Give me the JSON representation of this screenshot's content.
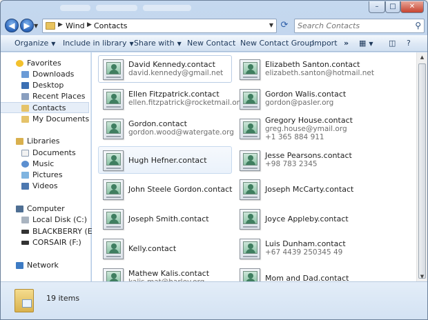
{
  "nav": {
    "back": "◀",
    "forward": "▶"
  },
  "address": {
    "crumbs": [
      "Wind",
      "Contacts"
    ]
  },
  "search": {
    "placeholder": "Search Contacts"
  },
  "commands": {
    "organize": "Organize",
    "include": "Include in library",
    "share": "Share with",
    "new_contact": "New Contact",
    "new_group": "New Contact Group",
    "import": "Import",
    "more": "»"
  },
  "sidebar": {
    "favorites": "Favorites",
    "downloads": "Downloads",
    "desktop": "Desktop",
    "recent": "Recent Places",
    "contacts": "Contacts",
    "documents_fav": "My Documents",
    "libraries": "Libraries",
    "lib_documents": "Documents",
    "lib_music": "Music",
    "lib_pictures": "Pictures",
    "lib_videos": "Videos",
    "computer": "Computer",
    "disk_c": "Local Disk (C:)",
    "disk_e": "BLACKBERRY (E:)",
    "disk_f": "CORSAIR (F:)",
    "network": "Network"
  },
  "contacts": [
    {
      "name": "David Kennedy.contact",
      "lines": [
        "david.kennedy@gmail.net"
      ]
    },
    {
      "name": "Elizabeth Santon.contact",
      "lines": [
        "elizabeth.santon@hotmail.net"
      ]
    },
    {
      "name": "Ellen Fitzpatrick.contact",
      "lines": [
        "ellen.fitzpatrick@rocketmail.org"
      ]
    },
    {
      "name": "Gordon Walis.contact",
      "lines": [
        "gordon@pasler.org"
      ]
    },
    {
      "name": "Gordon.contact",
      "lines": [
        "gordon.wood@watergate.org"
      ]
    },
    {
      "name": "Gregory House.contact",
      "lines": [
        "greg.house@ymail.org",
        "+1 365 884 911"
      ]
    },
    {
      "name": "Hugh Hefner.contact",
      "lines": []
    },
    {
      "name": "Jesse Pearsons.contact",
      "lines": [
        "+98 783 2345"
      ]
    },
    {
      "name": "John Steele Gordon.contact",
      "lines": []
    },
    {
      "name": "Joseph McCarty.contact",
      "lines": []
    },
    {
      "name": "Joseph Smith.contact",
      "lines": []
    },
    {
      "name": "Joyce Appleby.contact",
      "lines": []
    },
    {
      "name": "Kelly.contact",
      "lines": []
    },
    {
      "name": "Luis Dunham.contact",
      "lines": [
        "+67 4439 250345 49"
      ]
    },
    {
      "name": "Mathew Kalis.contact",
      "lines": [
        "kalis.mat@harley.org"
      ]
    },
    {
      "name": "Mom and Dad.contact",
      "lines": []
    }
  ],
  "status": {
    "count": "19 items"
  },
  "colors": {
    "accent": "#2b5da8",
    "selection": "#e6eef8"
  }
}
